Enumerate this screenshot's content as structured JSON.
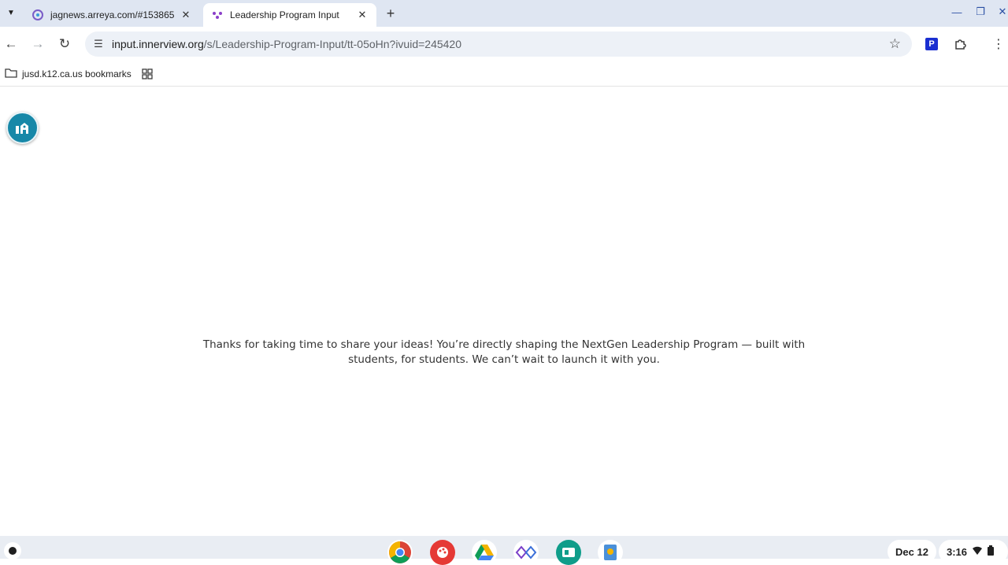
{
  "tabs": [
    {
      "title": "jagnews.arreya.com/#153865",
      "favicon": "jagnews-favicon-icon"
    },
    {
      "title": "Leadership Program Input",
      "favicon": "innerview-favicon-icon"
    }
  ],
  "address_bar": {
    "domain": "input.innerview.org",
    "path": "/s/Leadership-Program-Input/tt-05oHn?ivuid=245420"
  },
  "bookmarks": {
    "folder_label": "jusd.k12.ca.us bookmarks"
  },
  "page": {
    "message_line1": "Thanks for taking  time to share your ideas! You’re directly shaping the NextGen Leadership Program — built with",
    "message_line2": "students, for students. We can’t wait to launch it with you."
  },
  "shelf": {
    "apps": [
      "chrome-icon",
      "palette-icon",
      "drive-icon",
      "innerview-icon",
      "classroom-icon",
      "keep-icon"
    ],
    "date": "Dec 12",
    "time": "3:16"
  },
  "colors": {
    "tabstrip": "#dfe6f2",
    "omnibox": "#edf1f7",
    "fab": "#1788a8",
    "shelf": "#e9edf3"
  }
}
